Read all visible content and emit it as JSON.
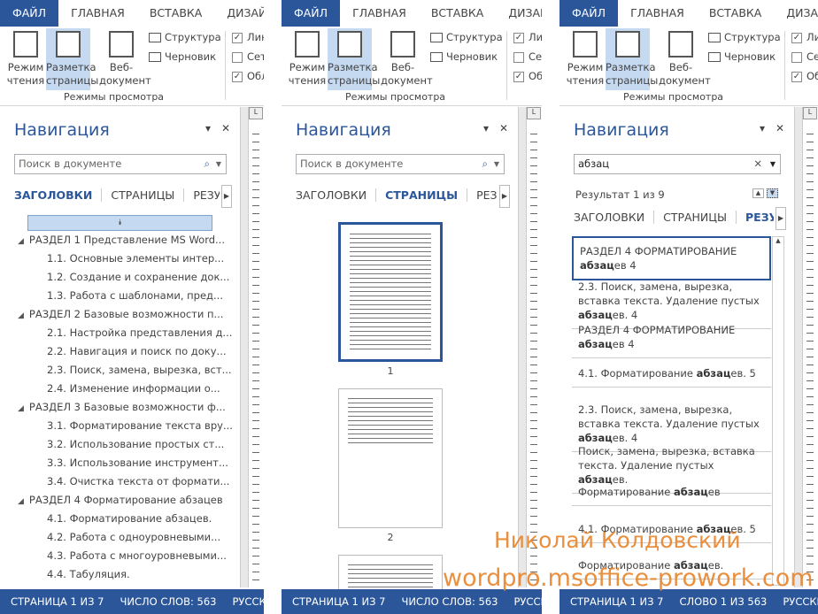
{
  "ribbon": {
    "tabs": [
      "ФАЙЛ",
      "ГЛАВНАЯ",
      "ВСТАВКА",
      "ДИЗАЙН"
    ],
    "read_mode": [
      "Режим",
      "чтения"
    ],
    "print_layout": [
      "Разметка",
      "страницы"
    ],
    "web_layout": [
      "Веб-",
      "документ"
    ],
    "outline": "Структура",
    "draft": "Черновик",
    "group_label": "Режимы просмотра",
    "checks": [
      {
        "label": "Лин",
        "checked": true
      },
      {
        "label": "Сет",
        "checked": false
      },
      {
        "label": "Обл",
        "checked": true
      }
    ]
  },
  "nav": {
    "title": "Навигация",
    "search_placeholder": "Поиск в документе",
    "search_value": "абзац",
    "tabs": [
      "ЗАГОЛОВКИ",
      "СТРАНИЦЫ",
      "РЕЗУЛЬ"
    ],
    "result_count": "Результат 1 из 9"
  },
  "headings": [
    {
      "level": 1,
      "text": "РАЗДЕЛ 1 Представление MS Word..."
    },
    {
      "level": 2,
      "text": "1.1. Основные элементы интер..."
    },
    {
      "level": 2,
      "text": "1.2. Создание и сохранение док..."
    },
    {
      "level": 2,
      "text": "1.3. Работа с шаблонами, пред..."
    },
    {
      "level": 1,
      "text": "РАЗДЕЛ 2 Базовые возможности п..."
    },
    {
      "level": 2,
      "text": "2.1. Настройка представления д..."
    },
    {
      "level": 2,
      "text": "2.2. Навигация и поиск по доку..."
    },
    {
      "level": 2,
      "text": "2.3. Поиск, замена, вырезка, вст..."
    },
    {
      "level": 2,
      "text": "2.4. Изменение информации о..."
    },
    {
      "level": 1,
      "text": "РАЗДЕЛ 3 Базовые возможности ф..."
    },
    {
      "level": 2,
      "text": "3.1. Форматирование текста вру..."
    },
    {
      "level": 2,
      "text": "3.2. Использование простых ст..."
    },
    {
      "level": 2,
      "text": "3.3. Использование инструмент..."
    },
    {
      "level": 2,
      "text": "3.4. Очистка текста от формати..."
    },
    {
      "level": 1,
      "text": "РАЗДЕЛ 4 Форматирование абзацев"
    },
    {
      "level": 2,
      "text": "4.1. Форматирование абзацев."
    },
    {
      "level": 2,
      "text": "4.2. Работа с одноуровневыми..."
    },
    {
      "level": 2,
      "text": "4.3. Работа с многоуровневыми..."
    },
    {
      "level": 2,
      "text": "4.4. Табуляция."
    }
  ],
  "pages": [
    "1",
    "2"
  ],
  "results": [
    {
      "pre": "РАЗДЕЛ 4 ФОРМАТИРОВАНИЕ ",
      "bold": "абзац",
      "post": "ев 4"
    },
    {
      "pre": "2.3. Поиск, замена, вырезка, вставка текста. Удаление пустых ",
      "bold": "абзац",
      "post": "ев. 4"
    },
    {
      "pre": "РАЗДЕЛ 4 ФОРМАТИРОВАНИЕ ",
      "bold": "абзац",
      "post": "ев 4"
    },
    {
      "pre": "4.1. Форматирование ",
      "bold": "абзац",
      "post": "ев. 5"
    },
    {
      "pre": "2.3. Поиск, замена, вырезка, вставка текста. Удаление пустых ",
      "bold": "абзац",
      "post": "ев. 4"
    },
    {
      "pre": "Поиск, замена, вырезка, вставка текста. Удаление пустых ",
      "bold": "абзац",
      "post": "ев."
    },
    {
      "pre": "Форматирование ",
      "bold": "абзац",
      "post": "ев"
    },
    {
      "pre": "4.1. Форматирование ",
      "bold": "абзац",
      "post": "ев. 5"
    },
    {
      "pre": "Форматирование ",
      "bold": "абзац",
      "post": "ев."
    }
  ],
  "status": {
    "page": "СТРАНИЦА 1 ИЗ 7",
    "words": "ЧИСЛО СЛОВ: 563",
    "word_pos": "СЛОВО 1 ИЗ 563",
    "lang": "РУССКИЙ"
  },
  "watermark": {
    "name": "Николай Колдовский",
    "site": "wordpro.msoffice-prowork.com"
  },
  "colors": {
    "accent": "#2b579a",
    "selected": "#c5d9f1",
    "watermark": "#e8832a"
  }
}
